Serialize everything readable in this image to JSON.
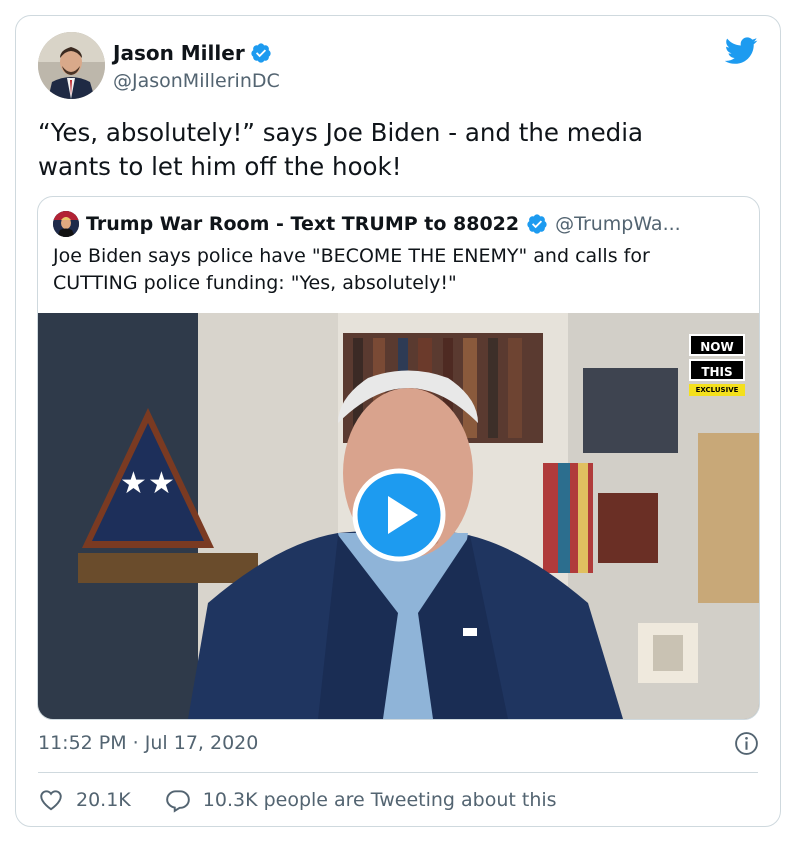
{
  "author": {
    "name": "Jason Miller",
    "handle": "@JasonMillerinDC"
  },
  "tweet": {
    "text": "“Yes, absolutely!” says Joe Biden - and the media\nwants to let him off the hook!",
    "timestamp": "11:52 PM · Jul 17, 2020"
  },
  "quoted": {
    "name": "Trump War Room - Text TRUMP to 88022",
    "handle": "@TrumpWa...",
    "text": "Joe Biden says police have \"BECOME THE ENEMY\" and calls for\nCUTTING police funding: \"Yes, absolutely!\"",
    "watermark": {
      "line1": "NOW",
      "line2": "THIS",
      "line3": "EXCLUSIVE"
    }
  },
  "actions": {
    "likes": "20.1K",
    "tweeting": "10.3K people are Tweeting about this"
  },
  "colors": {
    "accent": "#1d9bf0",
    "secondary_text": "#536471",
    "border": "#cfd9de"
  },
  "icons": [
    "verified-badge-icon",
    "twitter-bird-icon",
    "play-icon",
    "info-icon",
    "heart-icon",
    "comment-icon"
  ]
}
